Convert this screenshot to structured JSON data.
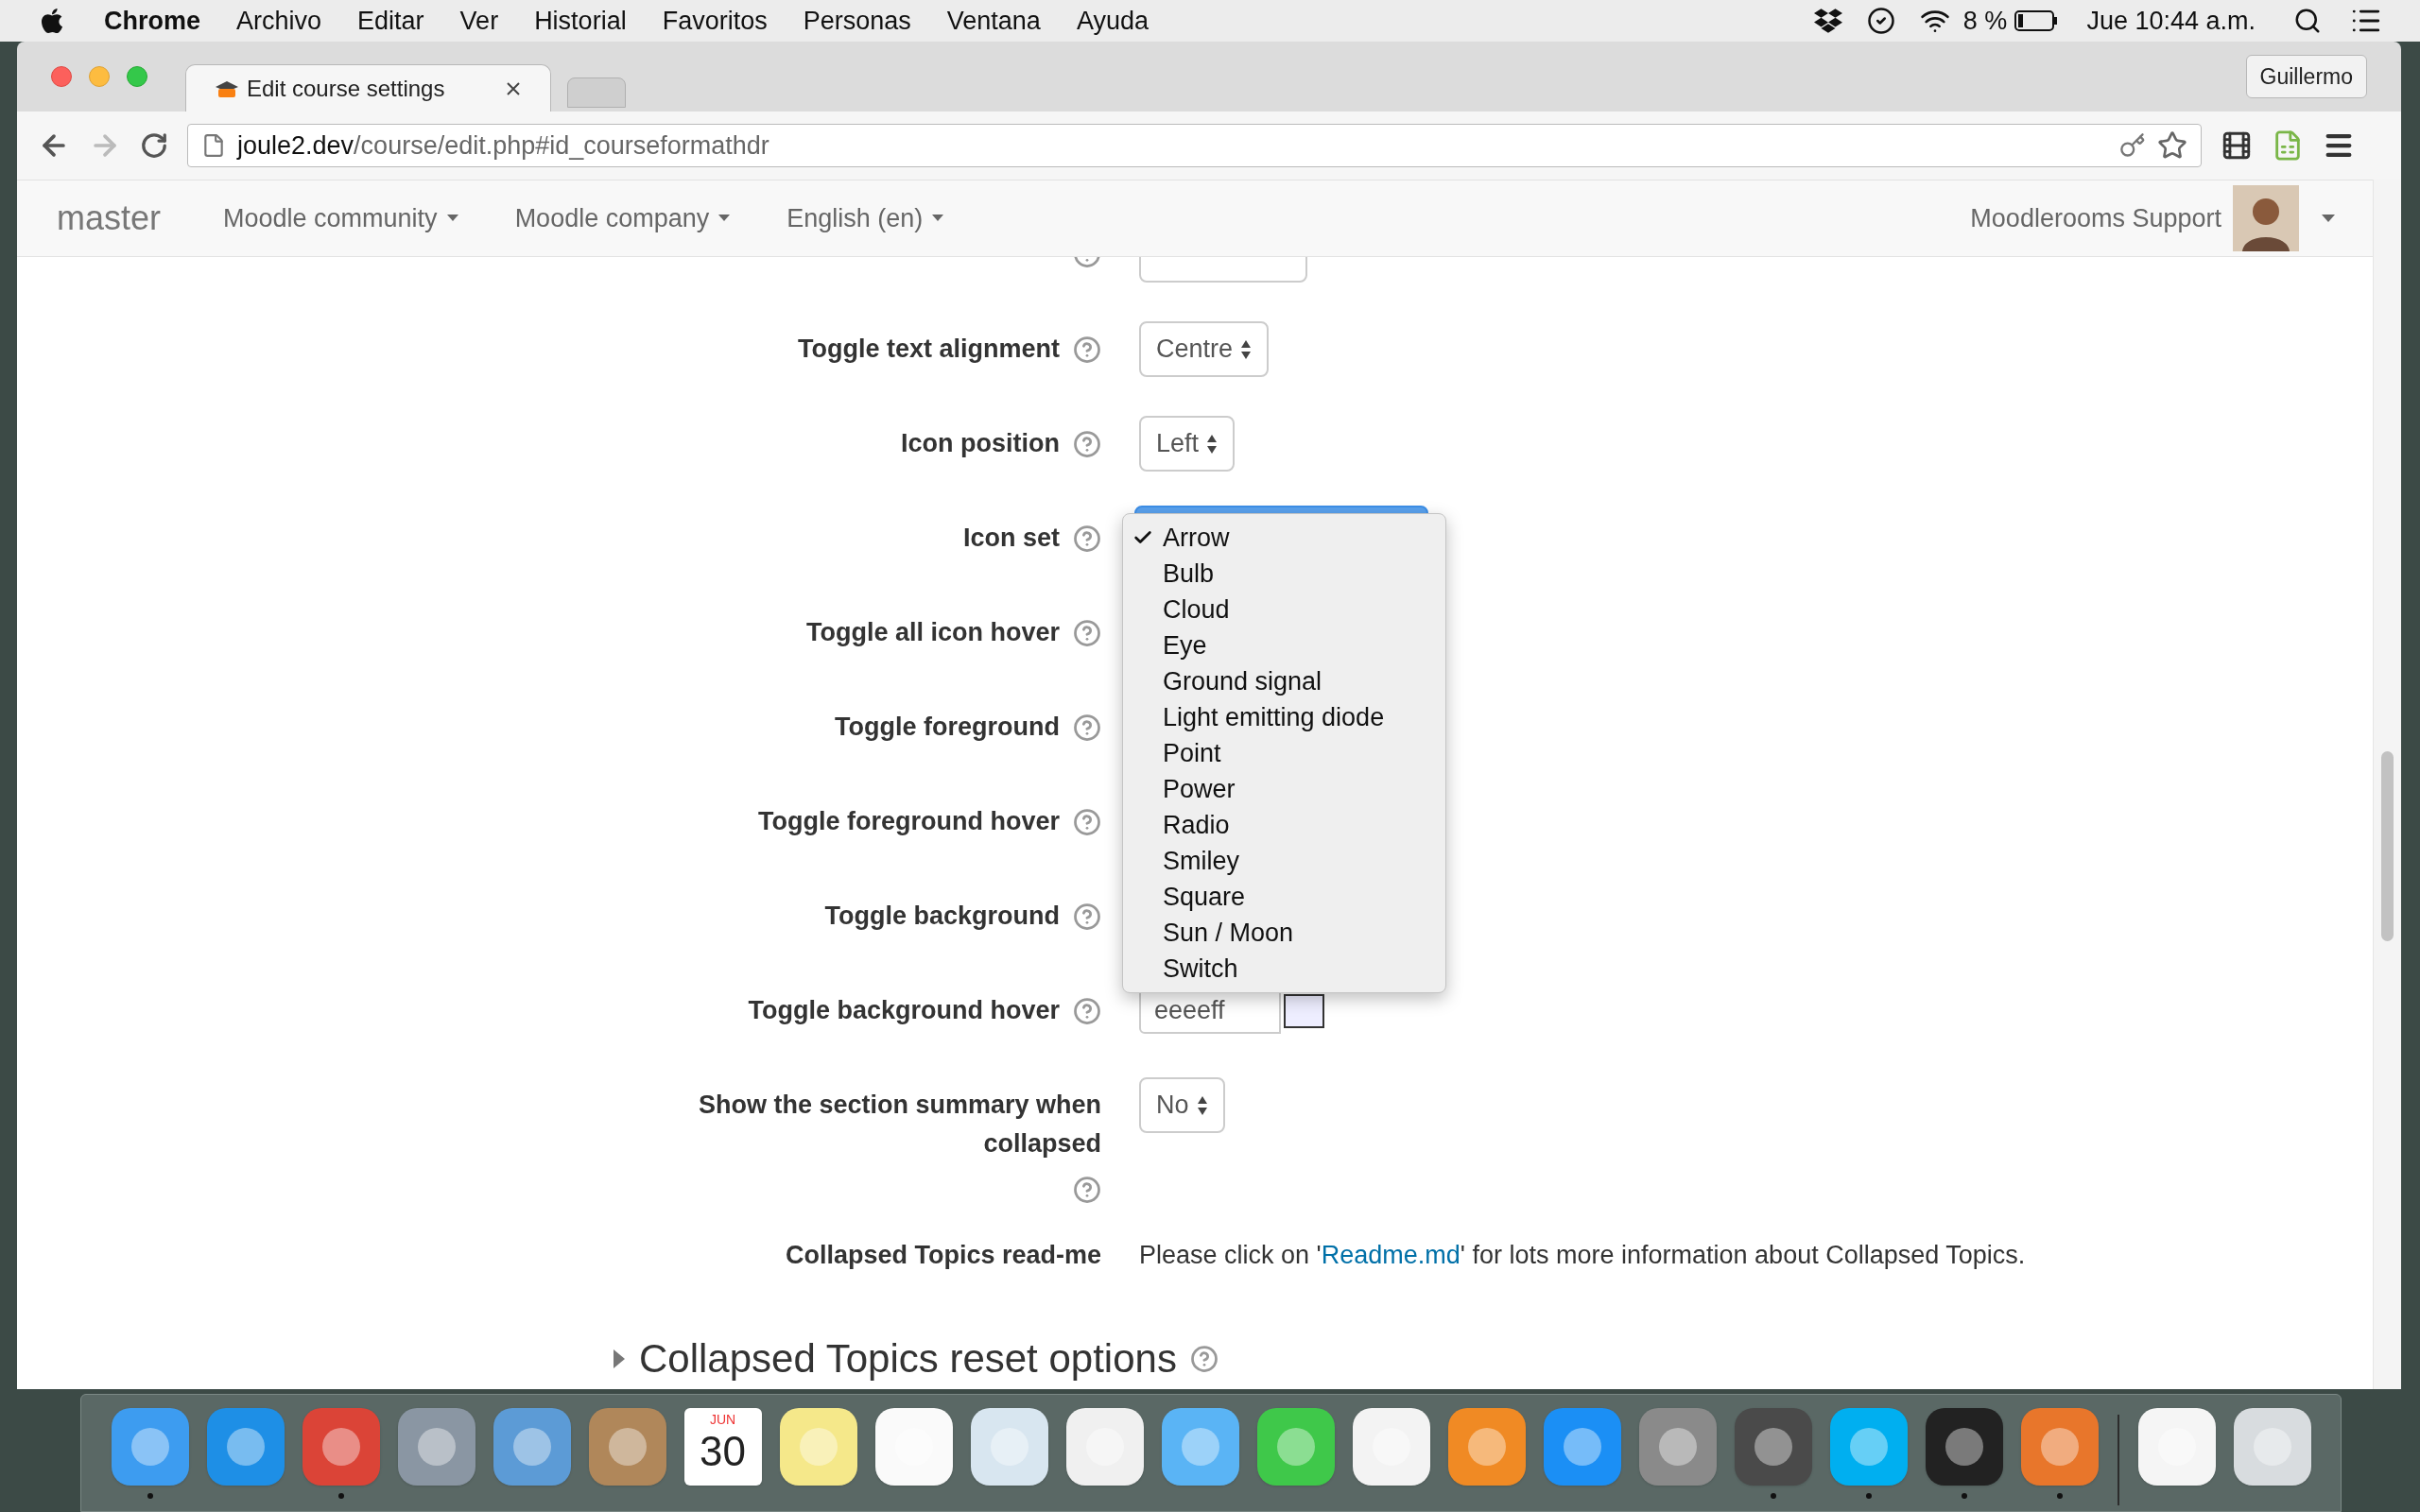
{
  "menu_bar": {
    "app": "Chrome",
    "items": [
      "Archivo",
      "Editar",
      "Ver",
      "Historial",
      "Favoritos",
      "Personas",
      "Ventana",
      "Ayuda"
    ],
    "battery": "8 %",
    "clock": "Jue 10:44 a.m."
  },
  "browser": {
    "tab": {
      "title": "Edit course settings",
      "selected": true
    },
    "profile": "Guillermo",
    "url_host": "joule2.dev",
    "url_path": "/course/edit.php#id_courseformathdr"
  },
  "navbar": {
    "brand": "master",
    "menus": [
      "Moodle community",
      "Moodle company",
      "English (en)"
    ],
    "user": "Moodlerooms Support"
  },
  "form": {
    "rows": [
      {
        "kind": "clipped"
      },
      {
        "label": "Toggle text alignment",
        "kind": "select",
        "value": "Centre"
      },
      {
        "label": "Icon position",
        "kind": "select",
        "value": "Left"
      },
      {
        "label": "Icon set",
        "kind": "open_select",
        "options": [
          {
            "label": "Arrow",
            "selected": true
          },
          {
            "label": "Bulb",
            "selected": false
          },
          {
            "label": "Cloud",
            "selected": false
          },
          {
            "label": "Eye",
            "selected": false
          },
          {
            "label": "Ground signal",
            "selected": false
          },
          {
            "label": "Light emitting diode",
            "selected": false
          },
          {
            "label": "Point",
            "selected": false
          },
          {
            "label": "Power",
            "selected": false
          },
          {
            "label": "Radio",
            "selected": false
          },
          {
            "label": "Smiley",
            "selected": false
          },
          {
            "label": "Square",
            "selected": false
          },
          {
            "label": "Sun / Moon",
            "selected": false
          },
          {
            "label": "Switch",
            "selected": false
          }
        ]
      },
      {
        "label": "Toggle all icon hover",
        "kind": "covered"
      },
      {
        "label": "Toggle foreground",
        "kind": "covered"
      },
      {
        "label": "Toggle foreground hover",
        "kind": "covered"
      },
      {
        "label": "Toggle background",
        "kind": "covered"
      },
      {
        "label": "Toggle background hover",
        "kind": "color",
        "value": "eeeeff"
      },
      {
        "label": "Show the section summary when collapsed",
        "kind": "select",
        "value": "No"
      },
      {
        "label": "Collapsed Topics read-me",
        "kind": "text",
        "before": "Please click on '",
        "link": "Readme.md",
        "after": "' for lots more information about Collapsed Topics."
      }
    ]
  },
  "section": {
    "title": "Collapsed Topics reset options",
    "expanded": false
  },
  "dock": [
    {
      "kind": "app",
      "color": "#3d9cf0",
      "running": true
    },
    {
      "kind": "app",
      "color": "#1e8fe6",
      "running": false
    },
    {
      "kind": "app",
      "color": "#db4437",
      "running": true
    },
    {
      "kind": "app",
      "color": "#8a96a3",
      "running": false
    },
    {
      "kind": "app",
      "color": "#5c9bd6",
      "running": false
    },
    {
      "kind": "app",
      "color": "#b0875a",
      "running": false
    },
    {
      "kind": "calendar",
      "month": "JUN",
      "day": "30",
      "running": false
    },
    {
      "kind": "app",
      "color": "#f5e88a",
      "running": false
    },
    {
      "kind": "app",
      "color": "#fafafa",
      "running": false
    },
    {
      "kind": "app",
      "color": "#d8e6f0",
      "running": false
    },
    {
      "kind": "app",
      "color": "#f0f0f0",
      "running": false
    },
    {
      "kind": "app",
      "color": "#5ab4f5",
      "running": false
    },
    {
      "kind": "app",
      "color": "#3fc84a",
      "running": false
    },
    {
      "kind": "app",
      "color": "#f3f3f3",
      "running": false
    },
    {
      "kind": "app",
      "color": "#f08a24",
      "running": false
    },
    {
      "kind": "app",
      "color": "#1b8ff5",
      "running": false
    },
    {
      "kind": "app",
      "color": "#8a8a8a",
      "running": false
    },
    {
      "kind": "app",
      "color": "#4a4a4a",
      "running": true
    },
    {
      "kind": "app",
      "color": "#00aff0",
      "running": true
    },
    {
      "kind": "app",
      "color": "#222222",
      "running": true
    },
    {
      "kind": "app",
      "color": "#e8762b",
      "running": true
    },
    {
      "kind": "separator"
    },
    {
      "kind": "app",
      "color": "#f5f5f5",
      "running": false
    },
    {
      "kind": "app",
      "color": "#d8dcdf",
      "running": false
    }
  ]
}
